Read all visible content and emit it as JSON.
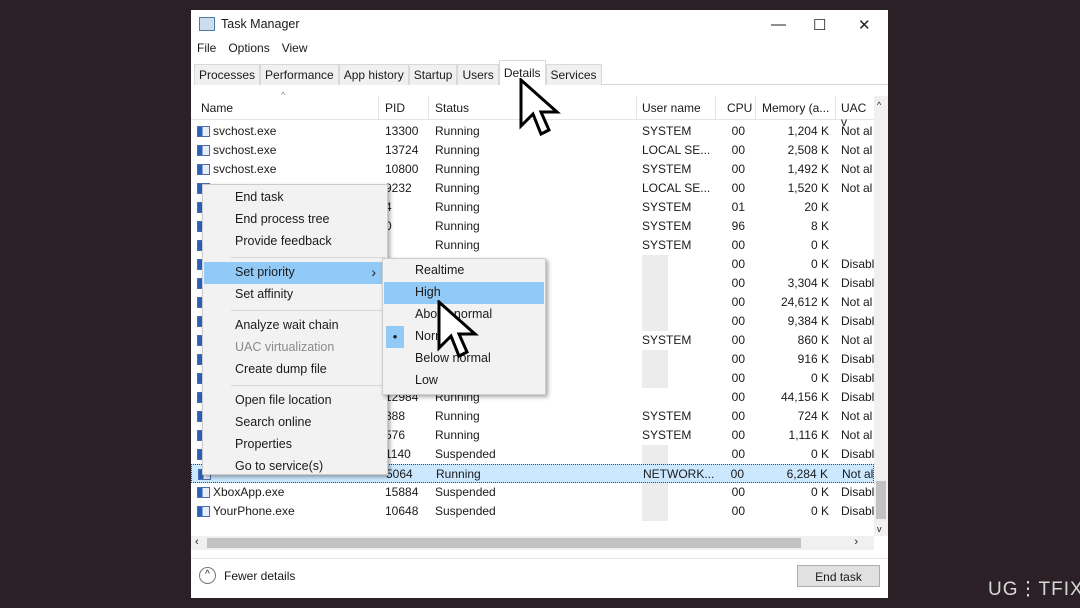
{
  "window": {
    "title": "Task Manager",
    "minimize": "—",
    "maximize": "☐",
    "close": "✕"
  },
  "menubar": [
    "File",
    "Options",
    "View"
  ],
  "tabs": [
    {
      "label": "Processes"
    },
    {
      "label": "Performance"
    },
    {
      "label": "App history"
    },
    {
      "label": "Startup"
    },
    {
      "label": "Users"
    },
    {
      "label": "Details",
      "active": true
    },
    {
      "label": "Services"
    }
  ],
  "columns": {
    "name": "Name",
    "pid": "PID",
    "status": "Status",
    "user": "User name",
    "cpu": "CPU",
    "memory": "Memory (a...",
    "uac": "UAC v"
  },
  "rows": [
    [
      "svchost.exe",
      "13300",
      "Running",
      "SYSTEM",
      "00",
      "1,204 K",
      "Not al"
    ],
    [
      "svchost.exe",
      "13724",
      "Running",
      "LOCAL SE...",
      "00",
      "2,508 K",
      "Not al"
    ],
    [
      "svchost.exe",
      "10800",
      "Running",
      "SYSTEM",
      "00",
      "1,492 K",
      "Not al"
    ],
    [
      "",
      "9232",
      "Running",
      "LOCAL SE...",
      "00",
      "1,520 K",
      "Not al"
    ],
    [
      "",
      "4",
      "Running",
      "SYSTEM",
      "01",
      "20 K",
      ""
    ],
    [
      "",
      "0",
      "Running",
      "SYSTEM",
      "96",
      "8 K",
      ""
    ],
    [
      "",
      "",
      "Running",
      "SYSTEM",
      "00",
      "0 K",
      ""
    ],
    [
      "",
      "",
      "",
      "",
      "00",
      "0 K",
      "Disabl"
    ],
    [
      "",
      "",
      "",
      "",
      "00",
      "3,304 K",
      "Disabl"
    ],
    [
      "",
      "",
      "",
      "",
      "00",
      "24,612 K",
      "Not al"
    ],
    [
      "",
      "",
      "",
      "",
      "00",
      "9,384 K",
      "Disabl"
    ],
    [
      "",
      "",
      "",
      "SYSTEM",
      "00",
      "860 K",
      "Not al"
    ],
    [
      "",
      "",
      "",
      "",
      "00",
      "916 K",
      "Disabl"
    ],
    [
      "",
      "",
      "",
      "",
      "00",
      "0 K",
      "Disabl"
    ],
    [
      "",
      "12984",
      "Running",
      "",
      "00",
      "44,156 K",
      "Disabl"
    ],
    [
      "",
      "388",
      "Running",
      "SYSTEM",
      "00",
      "724 K",
      "Not al"
    ],
    [
      "",
      "576",
      "Running",
      "SYSTEM",
      "00",
      "1,116 K",
      "Not al"
    ],
    [
      "",
      "1140",
      "Suspended",
      "",
      "00",
      "0 K",
      "Disabl"
    ],
    [
      "",
      "5064",
      "Running",
      "NETWORK...",
      "00",
      "6,284 K",
      "Not al"
    ],
    [
      "XboxApp.exe",
      "15884",
      "Suspended",
      "",
      "00",
      "0 K",
      "Disabl"
    ],
    [
      "YourPhone.exe",
      "10648",
      "Suspended",
      "",
      "00",
      "0 K",
      "Disabl"
    ]
  ],
  "selected_row": 18,
  "context_menu": [
    {
      "label": "End task"
    },
    {
      "label": "End process tree"
    },
    {
      "label": "Provide feedback"
    },
    {
      "sep": true
    },
    {
      "label": "Set priority",
      "submenu": true,
      "highlighted": true
    },
    {
      "label": "Set affinity"
    },
    {
      "sep": true
    },
    {
      "label": "Analyze wait chain"
    },
    {
      "label": "UAC virtualization",
      "disabled": true
    },
    {
      "label": "Create dump file"
    },
    {
      "sep": true
    },
    {
      "label": "Open file location"
    },
    {
      "label": "Search online"
    },
    {
      "label": "Properties"
    },
    {
      "label": "Go to service(s)"
    }
  ],
  "priority_submenu": [
    {
      "label": "Realtime"
    },
    {
      "label": "High",
      "highlighted": true
    },
    {
      "label": "Above normal"
    },
    {
      "label": "Normal",
      "checked": true
    },
    {
      "label": "Below normal"
    },
    {
      "label": "Low"
    }
  ],
  "footer": {
    "fewer_details": "Fewer details",
    "end_task": "End task"
  },
  "watermark": "UG⋮TFIX",
  "colors": {
    "highlight": "#91c9f7",
    "selected_row": "#cce8ff",
    "background": "#2b2026"
  }
}
